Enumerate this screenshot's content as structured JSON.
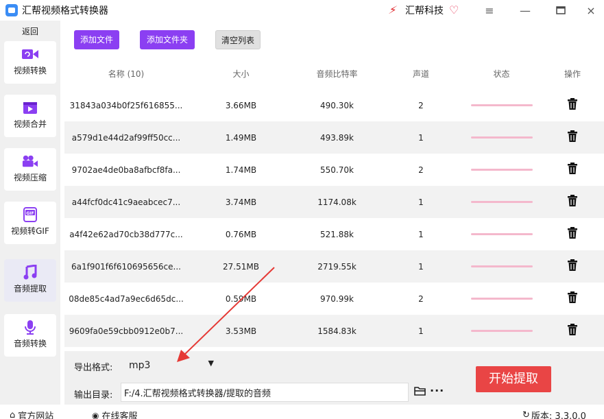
{
  "app": {
    "title": "汇帮视频格式转换器",
    "brand": "汇帮科技"
  },
  "window_controls": [
    "menu",
    "minimize",
    "maximize",
    "close"
  ],
  "sidebar": {
    "back_label": "返回",
    "items": [
      {
        "label": "视频转换",
        "icon": "video-convert-icon",
        "active": false
      },
      {
        "label": "视频合并",
        "icon": "video-merge-icon",
        "active": false
      },
      {
        "label": "视频压缩",
        "icon": "video-compress-icon",
        "active": false
      },
      {
        "label": "视频转GIF",
        "icon": "gif-icon",
        "active": false
      },
      {
        "label": "音频提取",
        "icon": "music-note-icon",
        "active": true
      },
      {
        "label": "音频转换",
        "icon": "microphone-icon",
        "active": false
      }
    ]
  },
  "toolbar": {
    "add_file": "添加文件",
    "add_folder": "添加文件夹",
    "clear_list": "清空列表"
  },
  "table": {
    "headers": [
      "名称 (10)",
      "大小",
      "音频比特率",
      "声道",
      "状态",
      "操作"
    ],
    "rows": [
      {
        "name": "31843a034b0f25f616855...",
        "size": "3.66MB",
        "bitrate": "490.30k",
        "channels": "2",
        "progress": 0
      },
      {
        "name": "a579d1e44d2af99ff50cc...",
        "size": "1.49MB",
        "bitrate": "493.89k",
        "channels": "1",
        "progress": 0
      },
      {
        "name": "9702ae4de0ba8afbcf8fa...",
        "size": "1.74MB",
        "bitrate": "550.70k",
        "channels": "2",
        "progress": 0
      },
      {
        "name": "a44fcf0dc41c9aeabcec7...",
        "size": "3.74MB",
        "bitrate": "1174.08k",
        "channels": "1",
        "progress": 0
      },
      {
        "name": "a4f42e62ad70cb38d777c...",
        "size": "0.76MB",
        "bitrate": "521.88k",
        "channels": "1",
        "progress": 0
      },
      {
        "name": "6a1f901f6f610695656ce...",
        "size": "27.51MB",
        "bitrate": "2719.55k",
        "channels": "1",
        "progress": 0
      },
      {
        "name": "08de85c4ad7a9ec6d65dc...",
        "size": "0.59MB",
        "bitrate": "970.99k",
        "channels": "2",
        "progress": 0
      },
      {
        "name": "9609fa0e59cbb0912e0b7...",
        "size": "3.53MB",
        "bitrate": "1584.83k",
        "channels": "1",
        "progress": 0
      }
    ]
  },
  "export": {
    "format_label": "导出格式:",
    "format_value": "mp3",
    "output_label": "输出目录:",
    "output_path": "F:/4.汇帮视频格式转换器/提取的音频",
    "start_button": "开始提取"
  },
  "statusbar": {
    "website": "官方网站",
    "support": "在线客服",
    "version": "版本: 3.3.0.0"
  },
  "colors": {
    "accent_purple": "#8b3ff2",
    "start_red": "#e94545",
    "progress_pink": "#f4b8cc",
    "annotation_red": "#e53935"
  }
}
